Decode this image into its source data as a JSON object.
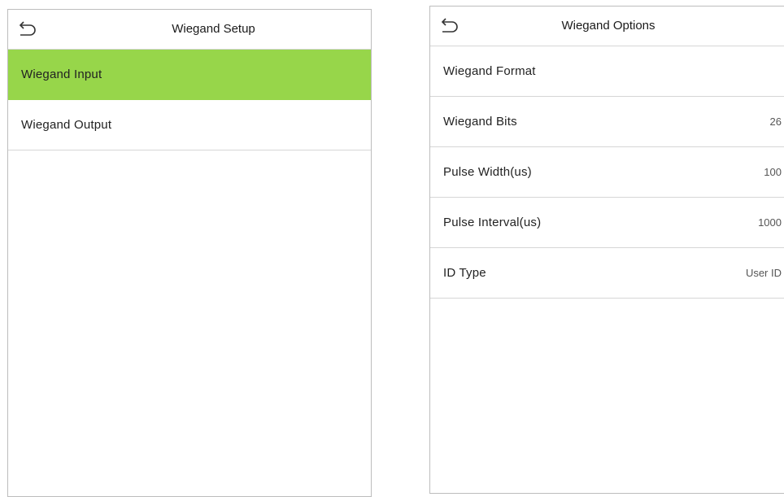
{
  "wiegand_setup": {
    "title": "Wiegand Setup",
    "items": [
      {
        "label": "Wiegand Input",
        "selected": true
      },
      {
        "label": "Wiegand Output",
        "selected": false
      }
    ],
    "highlight_color": "#97d64a"
  },
  "wiegand_options": {
    "title": "Wiegand Options",
    "items": [
      {
        "label": "Wiegand Format",
        "value": ""
      },
      {
        "label": "Wiegand Bits",
        "value": "26"
      },
      {
        "label": "Pulse Width(us)",
        "value": "100"
      },
      {
        "label": "Pulse Interval(us)",
        "value": "1000"
      },
      {
        "label": "ID Type",
        "value": "User ID"
      }
    ]
  },
  "icons": {
    "back": "back-arrow-icon"
  }
}
